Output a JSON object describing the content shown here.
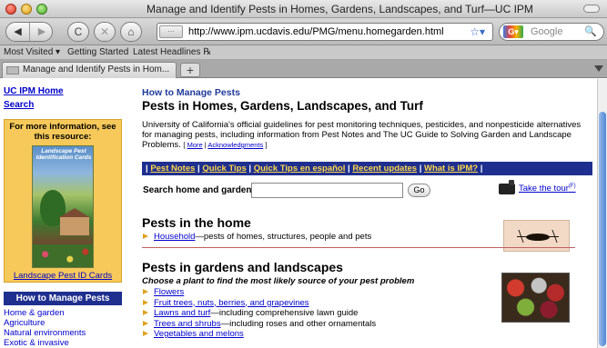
{
  "window": {
    "title": "Manage and Identify Pests in Homes, Gardens, Landscapes, and Turf—UC IPM"
  },
  "toolbar": {
    "back_icon": "◀",
    "forward_icon": "▶",
    "reload_icon": "C",
    "stop_icon": "✕",
    "home_icon": "⌂",
    "url": "http://www.ipm.ucdavis.edu/PMG/menu.homegarden.html",
    "search_placeholder": "Google",
    "search_icon": "🔍"
  },
  "bookmarks": [
    "Most Visited ▾",
    "Getting Started",
    "Latest Headlines ℞"
  ],
  "tabs": [
    {
      "label": "Manage and Identify Pests in Hom..."
    }
  ],
  "new_tab_label": "+",
  "sidebar": {
    "home_link": "UC IPM Home",
    "search_link": "Search",
    "promo_heading": "For more information, see this resource:",
    "card_title": "Landscape Pest Identification Cards",
    "card_link": "Landscape Pest ID Cards",
    "howto_header": "How to Manage Pests",
    "howto_items": [
      "Home & garden",
      "Agriculture",
      "Natural environments",
      "Exotic & invasive"
    ]
  },
  "main": {
    "kicker": "How to Manage Pests",
    "title": "Pests in Homes, Gardens, Landscapes, and Turf",
    "description": "University of California's official guidelines for pest monitoring techniques, pesticides, and nonpesticide alternatives for managing pests, including information from Pest Notes and The UC Guide to Solving Garden and Landscape Problems.",
    "more_link": "More",
    "ack_link": "Acknowledgments",
    "nav_links": [
      "Pest Notes",
      "Quick Tips",
      "Quick Tips en español",
      "Recent updates",
      "What is IPM?"
    ],
    "search_label": "Search home and garden:",
    "search_value": "",
    "go_label": "Go",
    "tour_link": "Take the tour",
    "tour_sup": "(F)",
    "sections": {
      "home": {
        "title": "Pests in the home",
        "items": [
          {
            "link": "Household",
            "rest": "—pests of homes, structures, people and pets"
          }
        ]
      },
      "garden": {
        "title": "Pests in gardens and landscapes",
        "subtitle": "Choose a plant to find the most likely source of your pest problem",
        "items": [
          {
            "link": "Flowers",
            "rest": ""
          },
          {
            "link": "Fruit trees, nuts, berries, and grapevines",
            "rest": ""
          },
          {
            "link": "Lawns and turf",
            "rest": "—including comprehensive lawn guide"
          },
          {
            "link": "Trees and shrubs",
            "rest": "—including roses and other ornamentals"
          },
          {
            "link": "Vegetables and melons",
            "rest": ""
          }
        ]
      }
    }
  }
}
